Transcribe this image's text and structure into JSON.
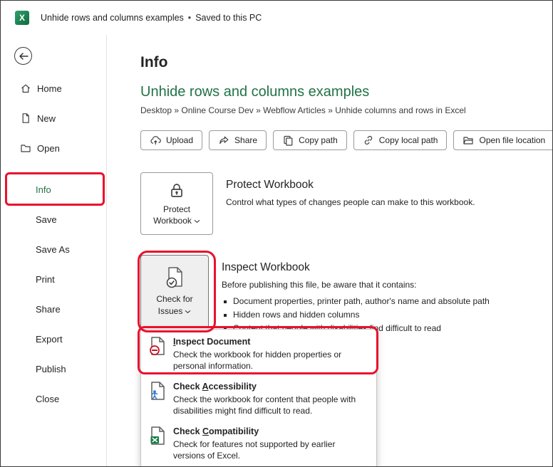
{
  "colors": {
    "excel_green": "#217346",
    "annotation_red": "#e8112d"
  },
  "titlebar": {
    "app_letter": "X",
    "title": "Unhide rows and columns examples",
    "separator": "•",
    "status": "Saved to this PC"
  },
  "sidebar": {
    "items": [
      {
        "label": "Home"
      },
      {
        "label": "New"
      },
      {
        "label": "Open"
      },
      {
        "label": "Info"
      },
      {
        "label": "Save"
      },
      {
        "label": "Save As"
      },
      {
        "label": "Print"
      },
      {
        "label": "Share"
      },
      {
        "label": "Export"
      },
      {
        "label": "Publish"
      },
      {
        "label": "Close"
      }
    ]
  },
  "info": {
    "page_title": "Info",
    "doc_title": "Unhide rows and columns examples",
    "breadcrumb": "Desktop » Online Course Dev » Webflow Articles » Unhide columns and rows in Excel",
    "actions": [
      {
        "label": "Upload"
      },
      {
        "label": "Share"
      },
      {
        "label": "Copy path"
      },
      {
        "label": "Copy local path"
      },
      {
        "label": "Open file location"
      }
    ],
    "protect": {
      "button_label": "Protect Workbook",
      "heading": "Protect Workbook",
      "description": "Control what types of changes people can make to this workbook."
    },
    "inspect": {
      "button_label": "Check for Issues",
      "heading": "Inspect Workbook",
      "description": "Before publishing this file, be aware that it contains:",
      "bullets": [
        {
          "text": "Document properties, printer path, author's name and absolute path"
        },
        {
          "text": "Hidden rows and hidden columns"
        },
        {
          "text": "Content that people with disabilities find difficult to read"
        }
      ]
    }
  },
  "menu": {
    "items": [
      {
        "title_pre": "",
        "accel": "I",
        "title_post": "nspect Document",
        "desc": "Check the workbook for hidden properties or personal information."
      },
      {
        "title_pre": "Check ",
        "accel": "A",
        "title_post": "ccessibility",
        "desc": "Check the workbook for content that people with disabilities might find difficult to read."
      },
      {
        "title_pre": "Check ",
        "accel": "C",
        "title_post": "ompatibility",
        "desc": "Check for features not supported by earlier versions of Excel."
      }
    ]
  }
}
